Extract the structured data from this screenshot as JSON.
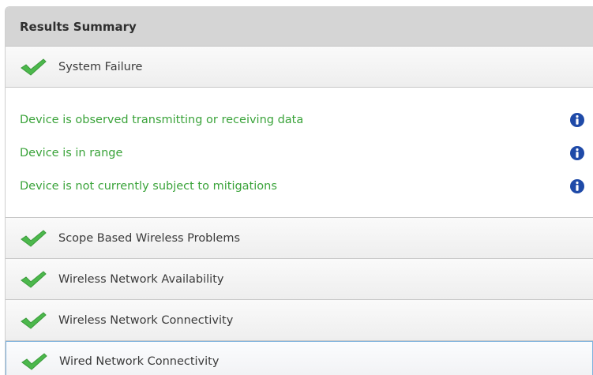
{
  "header": {
    "title": "Results Summary"
  },
  "sections": [
    {
      "label": "System Failure",
      "status_icon": "green-checkmark-icon",
      "expanded": true,
      "details": [
        {
          "text": "Device is observed transmitting or receiving data",
          "icon": "info-icon"
        },
        {
          "text": "Device is in range",
          "icon": "info-icon"
        },
        {
          "text": "Device is not currently subject to mitigations",
          "icon": "info-icon"
        }
      ]
    },
    {
      "label": "Scope Based Wireless Problems",
      "status_icon": "green-checkmark-icon",
      "expanded": false
    },
    {
      "label": "Wireless Network Availability",
      "status_icon": "green-checkmark-icon",
      "expanded": false
    },
    {
      "label": "Wireless Network Connectivity",
      "status_icon": "green-checkmark-icon",
      "expanded": false
    },
    {
      "label": "Wired Network Connectivity",
      "status_icon": "green-checkmark-icon",
      "expanded": false,
      "selected": true
    }
  ],
  "colors": {
    "pass_text": "#3aa33a",
    "check_green": "#4cb84c",
    "info_blue": "#1f4aa8",
    "header_bg": "#d5d5d5",
    "selected_border": "#7fb2dd"
  }
}
